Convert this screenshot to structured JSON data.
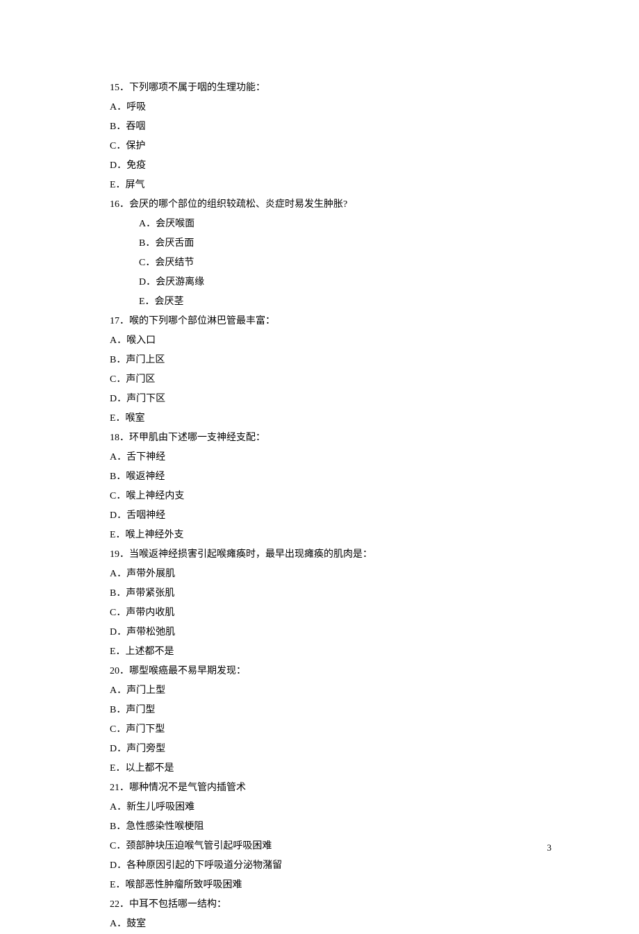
{
  "page_number": "3",
  "questions": [
    {
      "number": "15",
      "stem": "下列哪项不属于咽的生理功能：",
      "options": [
        {
          "letter": "A",
          "text": "呼吸",
          "indent": false
        },
        {
          "letter": "B",
          "text": "吞咽",
          "indent": false
        },
        {
          "letter": "C",
          "text": "保护",
          "indent": false
        },
        {
          "letter": "D",
          "text": "免疫",
          "indent": false
        },
        {
          "letter": "E",
          "text": "屏气",
          "indent": false
        }
      ]
    },
    {
      "number": "16",
      "stem": "会厌的哪个部位的组织较疏松、炎症时易发生肿胀?",
      "options": [
        {
          "letter": "A",
          "text": "会厌喉面",
          "indent": true
        },
        {
          "letter": "B",
          "text": "会厌舌面",
          "indent": true
        },
        {
          "letter": "C",
          "text": "会厌结节",
          "indent": true
        },
        {
          "letter": "D",
          "text": "会厌游离缘",
          "indent": true
        },
        {
          "letter": "E",
          "text": "会厌茎",
          "indent": true
        }
      ]
    },
    {
      "number": "17",
      "stem": "喉的下列哪个部位淋巴管最丰富：",
      "options": [
        {
          "letter": "A",
          "text": "喉入口",
          "indent": false
        },
        {
          "letter": "B",
          "text": "声门上区",
          "indent": false
        },
        {
          "letter": "C",
          "text": "声门区",
          "indent": false
        },
        {
          "letter": "D",
          "text": "声门下区",
          "indent": false
        },
        {
          "letter": "E",
          "text": "喉室",
          "indent": false
        }
      ]
    },
    {
      "number": "18",
      "stem": "环甲肌由下述哪一支神经支配：",
      "options": [
        {
          "letter": "A",
          "text": "舌下神经",
          "indent": false
        },
        {
          "letter": "B",
          "text": "喉返神经",
          "indent": false
        },
        {
          "letter": "C",
          "text": "喉上神经内支",
          "indent": false
        },
        {
          "letter": "D",
          "text": "舌咽神经",
          "indent": false
        },
        {
          "letter": "E",
          "text": "喉上神经外支",
          "indent": false
        }
      ]
    },
    {
      "number": "19",
      "stem": "当喉返神经损害引起喉瘫痪时，最早出现瘫痪的肌肉是：",
      "options": [
        {
          "letter": "A",
          "text": "声带外展肌",
          "indent": false
        },
        {
          "letter": "B",
          "text": "声带紧张肌",
          "indent": false
        },
        {
          "letter": "C",
          "text": "声带内收肌",
          "indent": false
        },
        {
          "letter": "D",
          "text": "声带松弛肌",
          "indent": false
        },
        {
          "letter": "E",
          "text": "上述都不是",
          "indent": false
        }
      ]
    },
    {
      "number": "20",
      "stem": "哪型喉癌最不易早期发现：",
      "options": [
        {
          "letter": "A",
          "text": "声门上型",
          "indent": false
        },
        {
          "letter": "B",
          "text": "声门型",
          "indent": false
        },
        {
          "letter": "C",
          "text": "声门下型",
          "indent": false
        },
        {
          "letter": "D",
          "text": "声门旁型",
          "indent": false
        },
        {
          "letter": "E",
          "text": "以上都不是",
          "indent": false
        }
      ]
    },
    {
      "number": "21",
      "stem": "哪种情况不是气管内插管术",
      "options": [
        {
          "letter": "A",
          "text": "新生儿呼吸困难",
          "indent": false
        },
        {
          "letter": "B",
          "text": "急性感染性喉梗阻",
          "indent": false
        },
        {
          "letter": "C",
          "text": "颈部肿块压迫喉气管引起呼吸困难",
          "indent": false
        },
        {
          "letter": "D",
          "text": "各种原因引起的下呼吸道分泌物潴留",
          "indent": false
        },
        {
          "letter": "E",
          "text": "喉部恶性肿瘤所致呼吸困难",
          "indent": false
        }
      ]
    },
    {
      "number": "22",
      "stem": "中耳不包括哪一结构：",
      "options": [
        {
          "letter": "A",
          "text": "鼓室",
          "indent": false
        }
      ]
    }
  ]
}
